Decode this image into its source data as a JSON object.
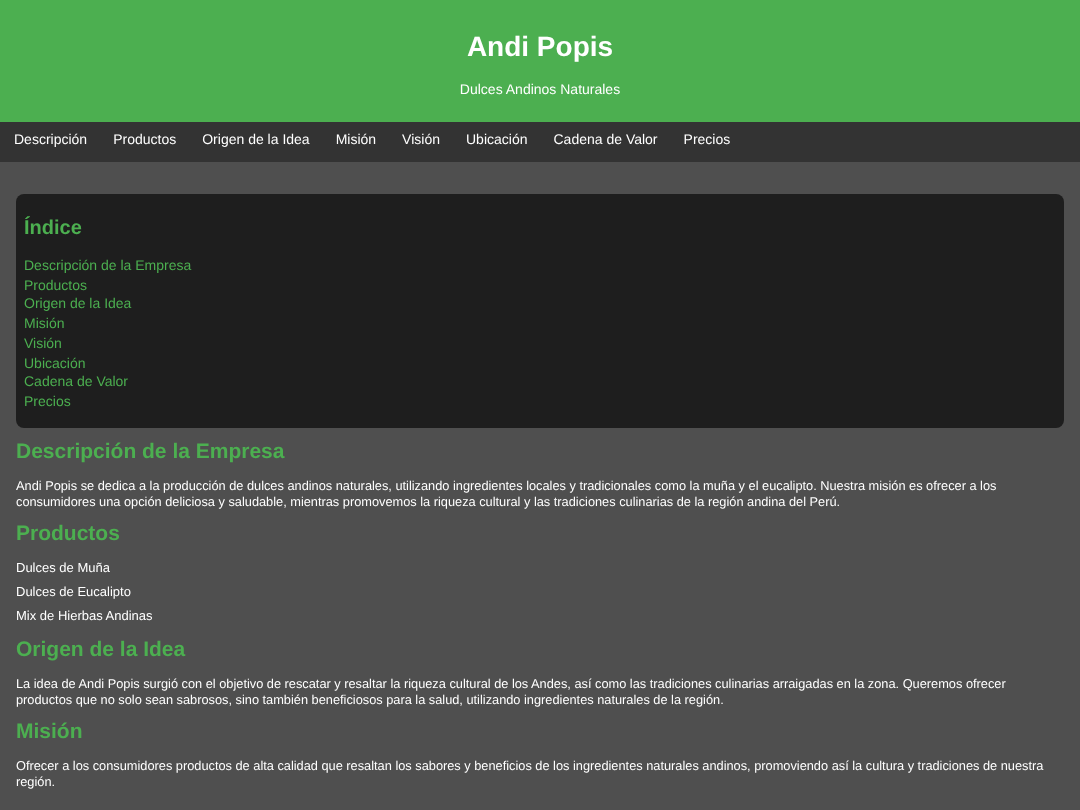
{
  "header": {
    "title": "Andi Popis",
    "subtitle": "Dulces Andinos Naturales"
  },
  "nav": [
    "Descripción",
    "Productos",
    "Origen de la Idea",
    "Misión",
    "Visión",
    "Ubicación",
    "Cadena de Valor",
    "Precios"
  ],
  "index": {
    "title": "Índice",
    "links": [
      "Descripción de la Empresa",
      "Productos",
      "Origen de la Idea",
      "Misión",
      "Visión",
      "Ubicación",
      "Cadena de Valor",
      "Precios"
    ]
  },
  "sections": [
    {
      "kind": "paragraph",
      "title": "Descripción de la Empresa",
      "text": "Andi Popis se dedica a la producción de dulces andinos naturales, utilizando ingredientes locales y tradicionales como la muña y el eucalipto. Nuestra misión es ofrecer a los consumidores una opción deliciosa y saludable, mientras promovemos la riqueza cultural y las tradiciones culinarias de la región andina del Perú."
    },
    {
      "kind": "list",
      "title": "Productos",
      "items": [
        "Dulces de Muña",
        "Dulces de Eucalipto",
        "Mix de Hierbas Andinas"
      ]
    },
    {
      "kind": "paragraph",
      "title": "Origen de la Idea",
      "text": "La idea de Andi Popis surgió con el objetivo de rescatar y resaltar la riqueza cultural de los Andes, así como las tradiciones culinarias arraigadas en la zona. Queremos ofrecer productos que no solo sean sabrosos, sino también beneficiosos para la salud, utilizando ingredientes naturales de la región."
    },
    {
      "kind": "paragraph",
      "title": "Misión",
      "text": "Ofrecer a los consumidores productos de alta calidad que resaltan los sabores y beneficios de los ingredientes naturales andinos, promoviendo así la cultura y tradiciones de nuestra región."
    }
  ]
}
